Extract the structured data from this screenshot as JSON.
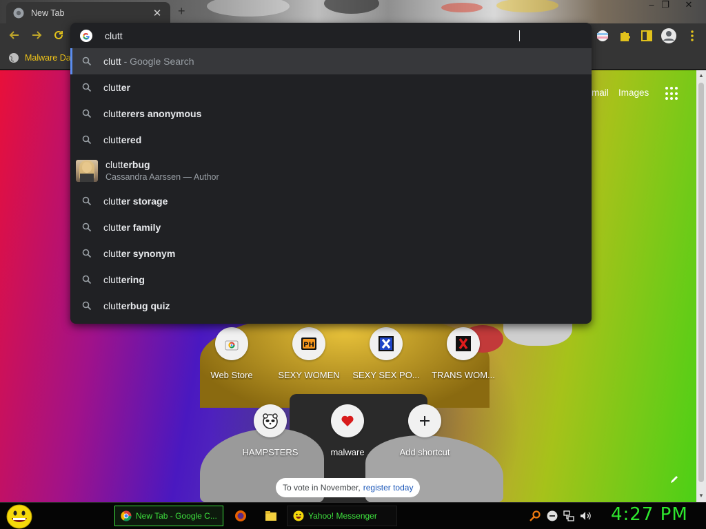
{
  "tab": {
    "title": "New Tab",
    "close": "✕",
    "new_tab": "+"
  },
  "window_controls": {
    "minimize": "–",
    "restore": "❐",
    "close": "✕"
  },
  "bookmarks": {
    "item_label": "Malware Da"
  },
  "omnibox": {
    "query": "clutt",
    "suggestions": [
      {
        "prefix": "clutt",
        "completion": "",
        "suffix": " - Google Search",
        "type": "search",
        "selected": true
      },
      {
        "prefix": "clutt",
        "completion": "er",
        "type": "search"
      },
      {
        "prefix": "clutt",
        "completion": "erers anonymous",
        "type": "search"
      },
      {
        "prefix": "clutt",
        "completion": "ered",
        "type": "search"
      },
      {
        "prefix": "clutt",
        "completion": "erbug",
        "type": "entity",
        "subtitle": "Cassandra Aarssen — Author"
      },
      {
        "prefix": "clutt",
        "completion": "er storage",
        "type": "search"
      },
      {
        "prefix": "clutt",
        "completion": "er family",
        "type": "search"
      },
      {
        "prefix": "clutt",
        "completion": "er synonym",
        "type": "search"
      },
      {
        "prefix": "clutt",
        "completion": "ering",
        "type": "search"
      },
      {
        "prefix": "clutt",
        "completion": "erbug quiz",
        "type": "search"
      }
    ]
  },
  "ntp": {
    "links": {
      "gmail": "mail",
      "images": "Images"
    },
    "shortcuts_row1": [
      {
        "label": "Web Store",
        "icon": "webstore-icon"
      },
      {
        "label": "SEXY WOMEN",
        "icon": "ph-icon"
      },
      {
        "label": "SEXY SEX PO...",
        "icon": "blue-x-icon"
      },
      {
        "label": "TRANS WOM...",
        "icon": "red-x-icon"
      }
    ],
    "shortcuts_row2": [
      {
        "label": "HAMPSTERS",
        "icon": "hamster-icon"
      },
      {
        "label": "malware",
        "icon": "heart-icon"
      },
      {
        "label": "Add shortcut",
        "icon": "plus-icon"
      }
    ],
    "vote": {
      "text": "To vote in November,",
      "link": "register today"
    }
  },
  "taskbar": {
    "chrome_task": "New Tab - Google C...",
    "yahoo_task": "Yahoo! Messenger",
    "clock": "4:27 PM"
  },
  "colors": {
    "accent_yellow": "#e2c21c",
    "taskbar_green": "#2ee82e",
    "selected_bar": "#5b8def"
  }
}
